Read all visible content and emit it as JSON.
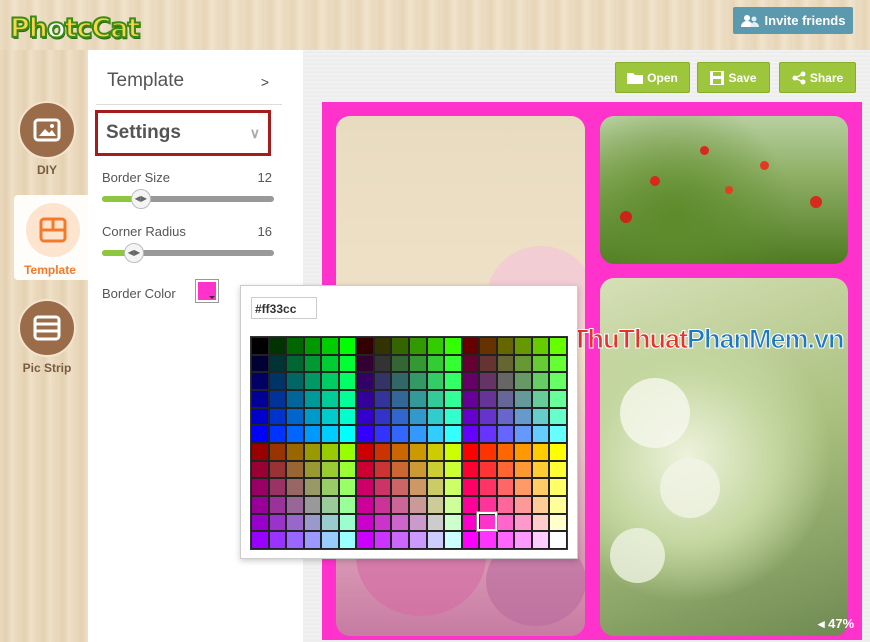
{
  "app": {
    "logo_text": "PhotoCat",
    "invite_label": "Invite friends"
  },
  "nav": {
    "items": [
      {
        "label": "DIY",
        "icon": "photo-icon"
      },
      {
        "label": "Template",
        "icon": "template-grid-icon"
      },
      {
        "label": "Pic Strip",
        "icon": "pic-strip-icon"
      }
    ]
  },
  "panel": {
    "template_label": "Template",
    "template_arrow": ">",
    "settings_label": "Settings",
    "settings_arrow": "∨",
    "border_size": {
      "label": "Border Size",
      "value": "12",
      "level": 0.22
    },
    "corner_radius": {
      "label": "Corner Radius",
      "value": "16",
      "level": 0.18
    },
    "border_color": {
      "label": "Border Color",
      "value": "#ff33cc"
    }
  },
  "toolbar": {
    "open_label": "Open",
    "save_label": "Save",
    "share_label": "Share"
  },
  "canvas": {
    "zoom": "47%",
    "border_color": "#ff33cc"
  },
  "watermark": {
    "part1": "ThuThuat",
    "part2": "PhanMem",
    "part3": ".vn"
  },
  "colorpicker": {
    "hex_value": "#ff33cc",
    "selected_row": 10,
    "selected_col": 13
  },
  "colors": {
    "accent_green": "#9dc63d",
    "invite_blue": "#5a99ae",
    "nav_active": "#f37a2a",
    "highlight_border": "#a41c1c"
  }
}
